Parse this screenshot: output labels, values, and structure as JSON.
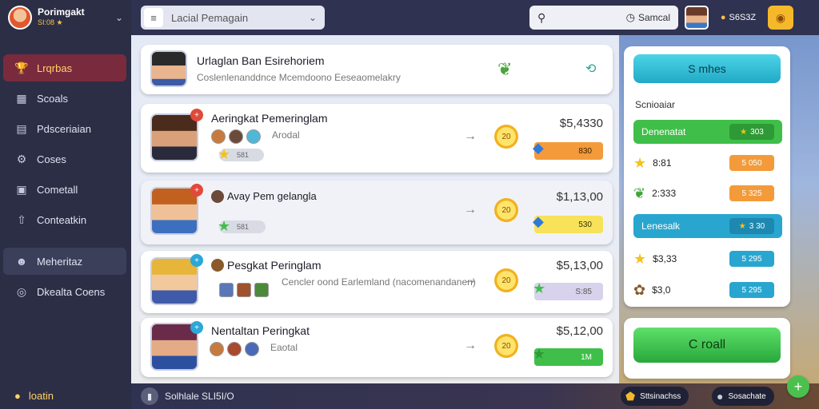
{
  "brand": {
    "title": "Porimgakt",
    "subtitle": "SI:08 ★"
  },
  "sidebar": {
    "items": [
      {
        "label": "Lrqrbas",
        "icon": "trophy-icon"
      },
      {
        "label": "Scoals",
        "icon": "chart-icon"
      },
      {
        "label": "Pdsceriaian",
        "icon": "document-icon"
      },
      {
        "label": "Coses",
        "icon": "gear-icon"
      },
      {
        "label": "Cometall",
        "icon": "calendar-icon"
      },
      {
        "label": "Conteatkin",
        "icon": "upload-icon"
      },
      {
        "label": "Meheritaz",
        "icon": "user-icon"
      },
      {
        "label": "Dkealta Coens",
        "icon": "settings-icon"
      }
    ],
    "bottom_label": "loatin"
  },
  "topbar": {
    "search_placeholder": "Lacial Pemagain",
    "search2_value": "Samcal",
    "coins": "S6S3Z"
  },
  "header_card": {
    "title": "Urlaglan Ban Esirehoriem",
    "subtitle": "Coslenlenanddnce Mcemdoono Eeseaomelakry"
  },
  "rows": [
    {
      "name": "Aeringkat Pemeringlam",
      "sub": "Arodal",
      "tag": "581",
      "price": "$5,4330",
      "pill": "830",
      "pill_color": "#f39b3a",
      "coin_label": "20"
    },
    {
      "name": "Avay Pem gelangla",
      "sub": "",
      "tag": "581",
      "price": "$1,13,00",
      "pill": "530",
      "pill_color": "#f7e25a",
      "coin_label": "20"
    },
    {
      "name": "Pesgkat Peringlam",
      "sub": "Cencler oond Earlemland (nacomenandanen)",
      "tag": "",
      "price": "$5,13,00",
      "pill": "S:85",
      "pill_color": "#d8d2ec",
      "coin_label": "20"
    },
    {
      "name": "Nentaltan Peringkat",
      "sub": "Eaotal",
      "tag": "",
      "price": "$5,12,00",
      "pill": "1M",
      "pill_color": "#3fbf49",
      "coin_label": "20"
    }
  ],
  "right_panel": {
    "cta": "S mhes",
    "section": "Scnioaiar",
    "rows": [
      {
        "label": "Denenatat",
        "chip": "303",
        "style": "bar-green"
      },
      {
        "label": "8:81",
        "chip": "5 050",
        "style": "plain-orange",
        "icon": "star-icon"
      },
      {
        "label": "2:333",
        "chip": "5 325",
        "style": "plain-orange",
        "icon": "gem-icon"
      },
      {
        "label": "Lenesalk",
        "chip": "3 30",
        "style": "bar-blue"
      },
      {
        "label": "$3,33",
        "chip": "5 295",
        "style": "plain-blue",
        "icon": "star-icon"
      },
      {
        "label": "$3,0",
        "chip": "5 295",
        "style": "plain-blue",
        "icon": "cookie-icon"
      }
    ],
    "green_button": "C roall"
  },
  "bottombar": {
    "status": "Solhlale SLI5I/O",
    "pill1": "Sttsinachss",
    "pill2": "Sosachate"
  },
  "colors": {
    "sidebar_bg": "#2b2e45",
    "active_bg": "#7a2a3d",
    "accent_gold": "#f5b82a",
    "accent_teal": "#21a9c7",
    "accent_green": "#3fbf49"
  }
}
